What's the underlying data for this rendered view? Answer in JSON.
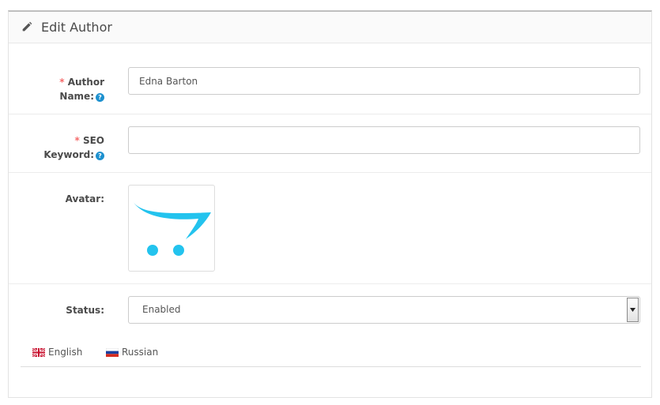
{
  "panel": {
    "title": "Edit Author",
    "title_icon": "pencil-icon"
  },
  "form": {
    "author_name": {
      "required_mark": "*",
      "label_line1": "Author",
      "label_line2": "Name:",
      "help_icon": "question-circle-icon",
      "value": "Edna Barton"
    },
    "seo_keyword": {
      "required_mark": "*",
      "label_line1": "SEO",
      "label_line2": "Keyword:",
      "help_icon": "question-circle-icon",
      "value": ""
    },
    "avatar": {
      "label": "Avatar:",
      "image_icon": "opencart-cart-logo"
    },
    "status": {
      "label": "Status:",
      "selected": "Enabled"
    }
  },
  "languages": {
    "tabs": [
      {
        "label": "English",
        "flag_icon": "uk-flag-icon"
      },
      {
        "label": "Russian",
        "flag_icon": "russia-flag-icon"
      }
    ]
  },
  "colors": {
    "help_icon": "#1e91cf",
    "required": "#f56b6b",
    "logo_cyan": "#23c3ee"
  }
}
